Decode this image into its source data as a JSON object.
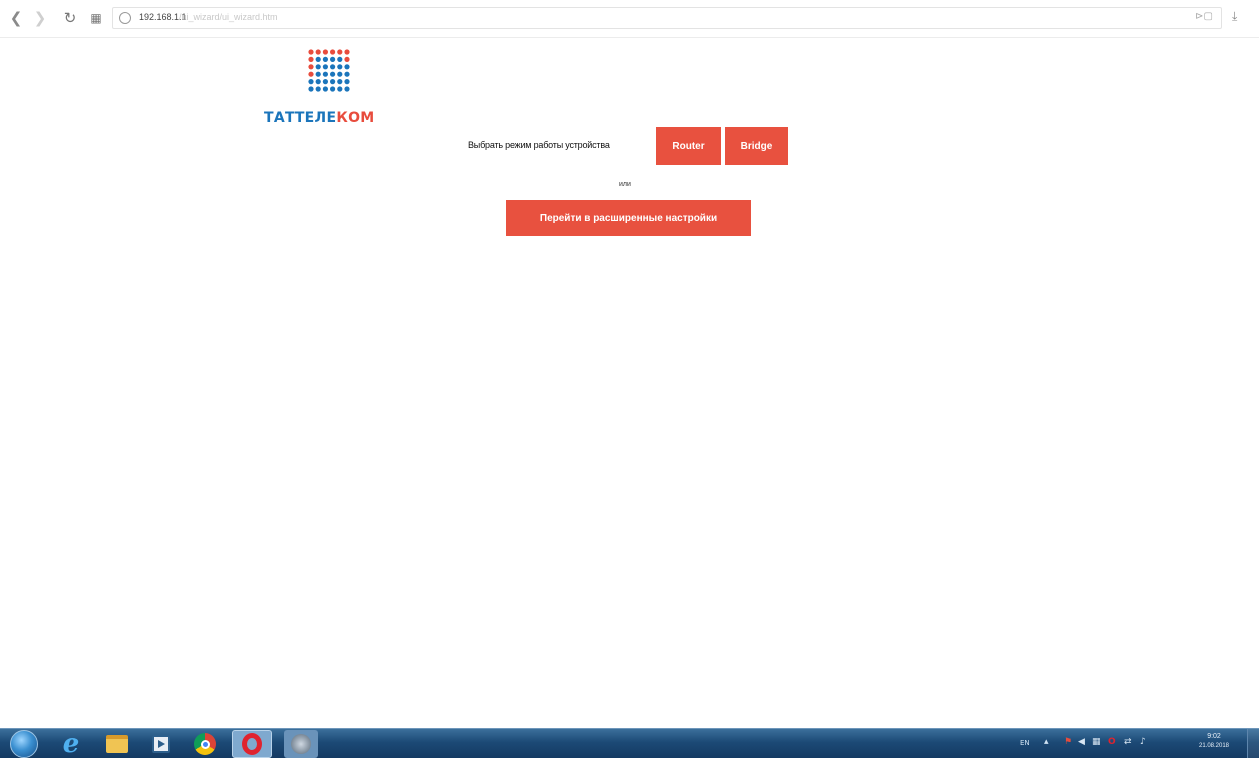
{
  "browser": {
    "url_host": "192.168.1.1",
    "url_path": "/ui_wizard/ui_wizard.htm",
    "url_right_icons": "⊳▢",
    "download_icon": "download-icon"
  },
  "logo": {
    "text_blue": "ТАТТЕЛЕ",
    "text_red": "КОМ",
    "colors": {
      "blue": "#1b75bb",
      "red": "#e84c3d"
    }
  },
  "mode": {
    "label": "Выбрать режим работы устройства",
    "router": "Router",
    "bridge": "Bridge",
    "or": "или",
    "advanced": "Перейти в расширенные настройки",
    "button_color": "#e8513f"
  },
  "taskbar": {
    "lang": "EN",
    "time": "9:02",
    "date": "21.08.2018"
  }
}
